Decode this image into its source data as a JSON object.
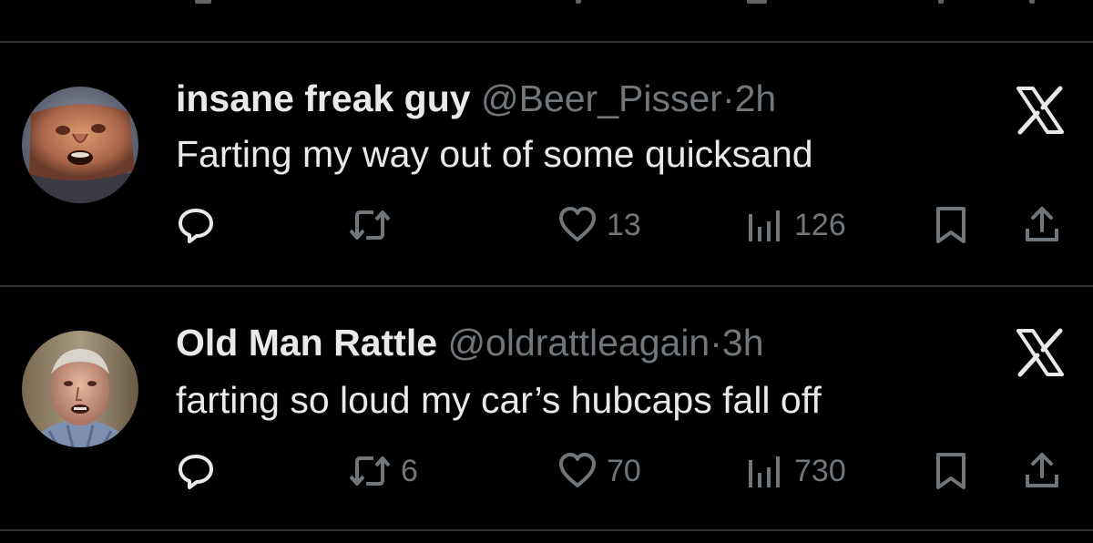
{
  "colors": {
    "background": "#000000",
    "text_primary": "#e7e9ea",
    "text_secondary": "#71767b",
    "divider": "#2f3336"
  },
  "tweets": [
    {
      "display_name": "insane freak guy",
      "handle": "@Beer_Pisser",
      "separator": "·",
      "time": "2h",
      "text": "Farting my way out of some quicksand",
      "reply_count": "",
      "retweet_count": "",
      "like_count": "13",
      "view_count": "126"
    },
    {
      "display_name": "Old Man Rattle",
      "handle": "@oldrattleagain",
      "separator": "·",
      "time": "3h",
      "text": "farting so loud my car’s hubcaps fall off",
      "reply_count": "",
      "retweet_count": "6",
      "like_count": "70",
      "view_count": "730"
    }
  ],
  "icons": {
    "reply": "reply-icon",
    "retweet": "retweet-icon",
    "like": "heart-icon",
    "views": "views-bar-chart-icon",
    "bookmark": "bookmark-icon",
    "share": "share-icon",
    "close": "x-logo-icon"
  }
}
